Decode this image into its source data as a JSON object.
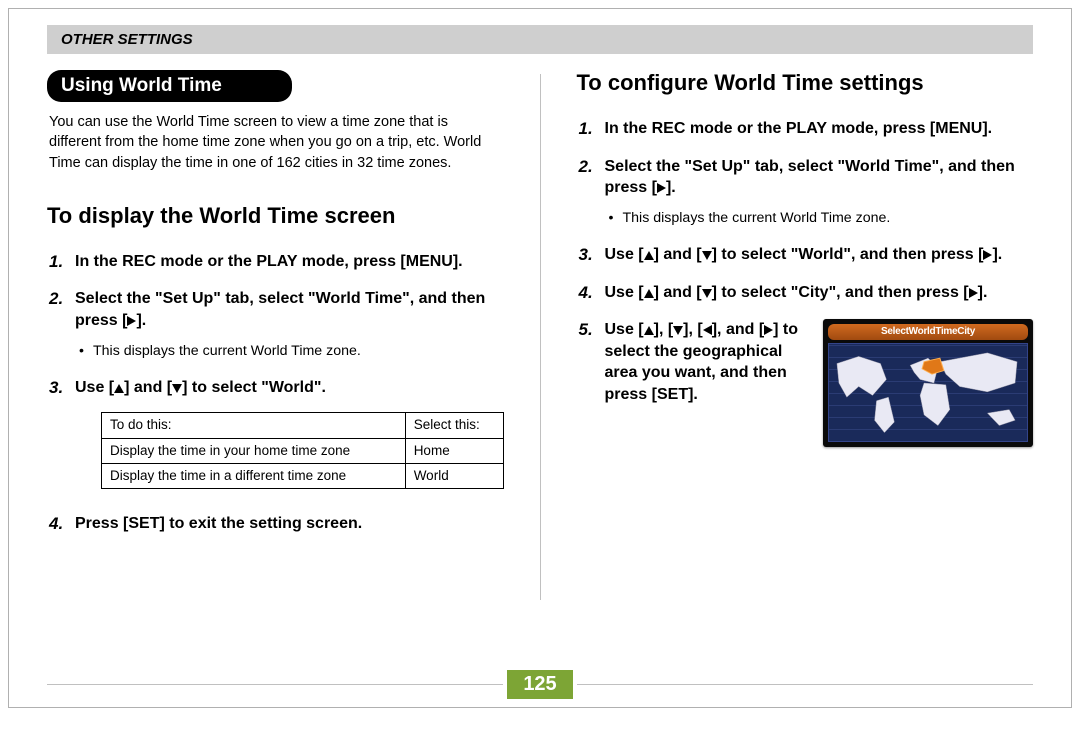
{
  "header": {
    "section_title": "OTHER SETTINGS"
  },
  "left": {
    "pill_title": "Using World Time",
    "intro": "You can use the World Time screen to view a time zone that is different from the home time zone when you go on a trip, etc. World Time can display the time in one of 162 cities in 32 time zones.",
    "heading": "To display the World Time screen",
    "steps": {
      "s1": "In the REC mode or the PLAY mode, press [MENU].",
      "s2_a": "Select the \"Set Up\" tab, select \"World Time\", and then press [",
      "s2_b": "].",
      "s2_sub": "This displays the current World Time zone.",
      "s3_a": "Use [",
      "s3_b": "] and [",
      "s3_c": "] to select \"World\".",
      "s4": "Press [SET] to exit the setting screen."
    },
    "table": {
      "h1": "To do this:",
      "h2": "Select this:",
      "r1c1": "Display the time in your home time zone",
      "r1c2": "Home",
      "r2c1": "Display the time in a different time zone",
      "r2c2": "World"
    }
  },
  "right": {
    "heading": "To configure World Time settings",
    "steps": {
      "s1": "In the REC mode or the PLAY mode, press [MENU].",
      "s2_a": "Select the \"Set Up\" tab, select \"World Time\", and then press [",
      "s2_b": "].",
      "s2_sub": "This displays the current World Time zone.",
      "s3_a": "Use [",
      "s3_b": "] and [",
      "s3_c": "] to select \"World\", and then press [",
      "s3_d": "].",
      "s4_a": "Use [",
      "s4_b": "] and [",
      "s4_c": "] to select \"City\", and then press [",
      "s4_d": "].",
      "s5_a": "Use [",
      "s5_b": "], [",
      "s5_c": "], [",
      "s5_d": "], and [",
      "s5_e": "] to select the geographical area you want, and then press [SET]."
    },
    "map_title": "SelectWorldTimeCity"
  },
  "page_number": "125"
}
